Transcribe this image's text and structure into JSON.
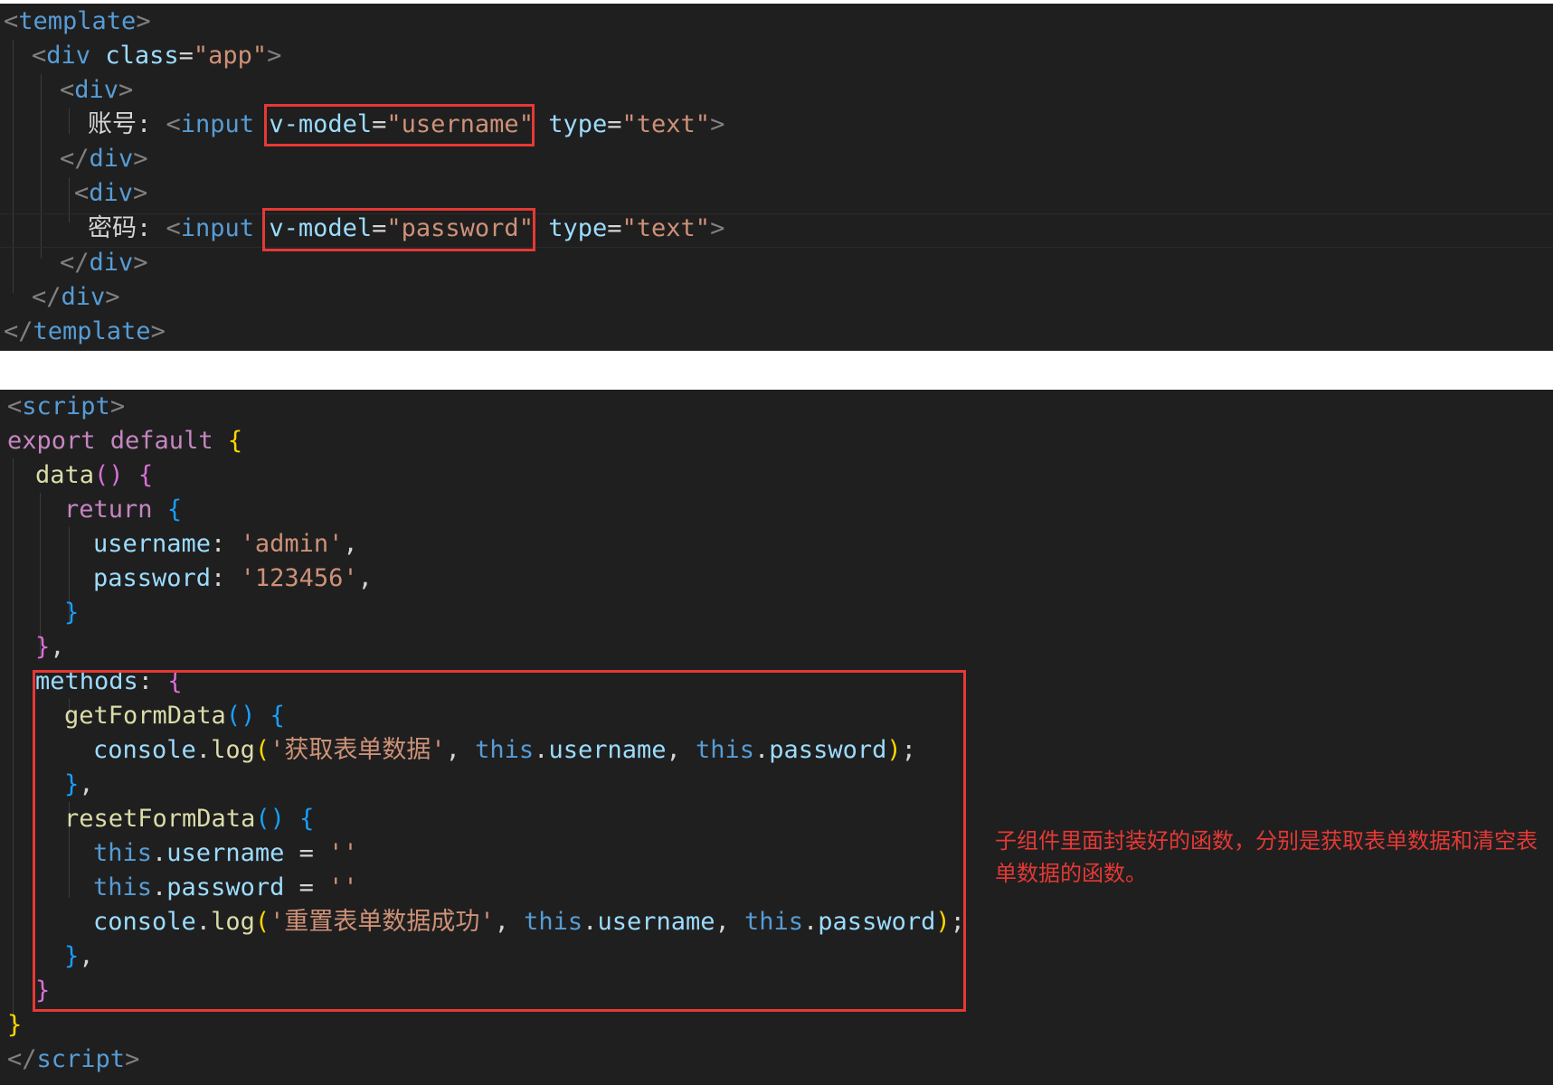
{
  "template_code": {
    "line1": {
      "open": "<",
      "tag": "template",
      "close": ">"
    },
    "line2": {
      "tag": "div",
      "attr": "class",
      "eq": "=",
      "value": "\"app\""
    },
    "line3": {
      "tag": "div"
    },
    "line4": {
      "label": "账号: ",
      "tag": "input",
      "model_attr": "v-model",
      "model_value": "\"username\"",
      "type_attr": "type",
      "type_value": "\"text\""
    },
    "line5": {
      "tag": "div"
    },
    "line6": {
      "tag": "div"
    },
    "line7": {
      "label": "密码: ",
      "tag": "input",
      "model_attr": "v-model",
      "model_value": "\"password\"",
      "type_attr": "type",
      "type_value": "\"text\""
    },
    "line8": {
      "tag": "div"
    },
    "line9": {
      "tag": "div"
    },
    "line10": {
      "tag": "template"
    }
  },
  "script_code": {
    "script_tag": "script",
    "export_kw": "export default ",
    "data_fn": "data",
    "return_kw": "return",
    "username_key": "username",
    "username_val": "'admin'",
    "password_key": "password",
    "password_val": "'123456'",
    "methods_key": "methods",
    "get_fn": "getFormData",
    "console": "console",
    "log": "log",
    "get_msg": "'获取表单数据'",
    "this_kw": "this",
    "username_prop": "username",
    "password_prop": "password",
    "reset_fn": "resetFormData",
    "empty_str": "''",
    "reset_msg": "'重置表单数据成功'"
  },
  "annotation": {
    "text": "子组件里面封装好的函数，分别是获取表单数据和清空表单数据的函数。"
  },
  "colors": {
    "highlight": "#e53935",
    "background": "#1f1f1f"
  }
}
